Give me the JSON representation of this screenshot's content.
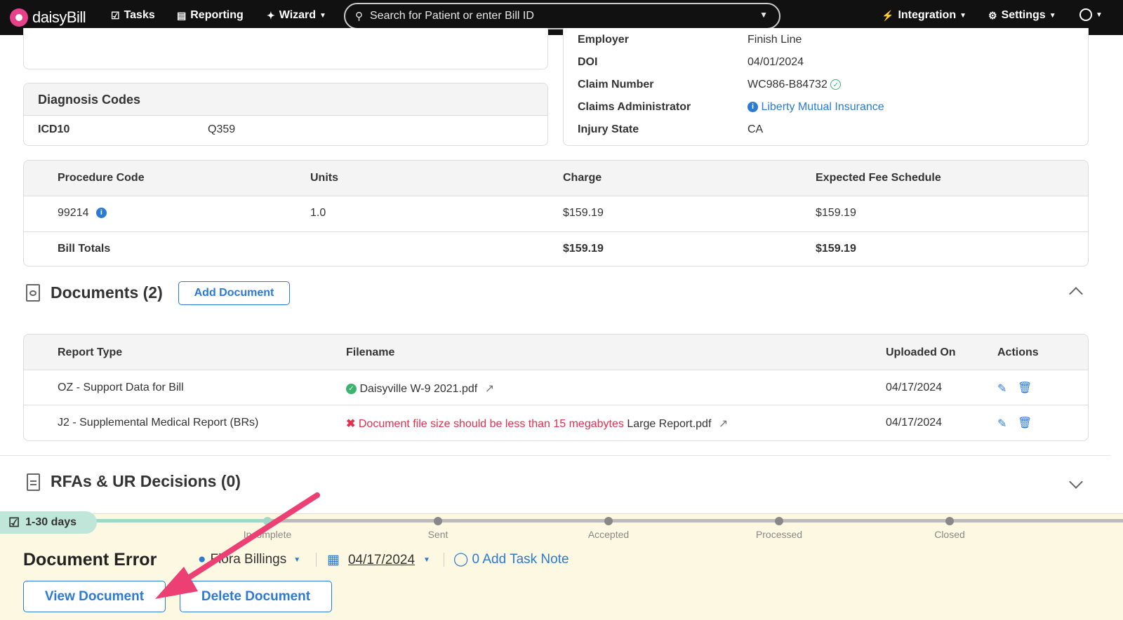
{
  "nav": {
    "logo_text": "daisyBill",
    "tasks": "Tasks",
    "reporting": "Reporting",
    "wizard": "Wizard",
    "search_placeholder": "Search for Patient or enter Bill ID",
    "integration": "Integration",
    "settings": "Settings"
  },
  "claim": {
    "rows": [
      {
        "label": "Employer",
        "value": "Finish Line"
      },
      {
        "label": "DOI",
        "value": "04/01/2024"
      },
      {
        "label": "Claim Number",
        "value": "WC986-B84732"
      },
      {
        "label": "Claims Administrator",
        "value": "Liberty Mutual Insurance"
      },
      {
        "label": "Injury State",
        "value": "CA"
      }
    ]
  },
  "diagnosis": {
    "title": "Diagnosis Codes",
    "code_type": "ICD10",
    "code": "Q359"
  },
  "procedures": {
    "headers": [
      "Procedure Code",
      "Units",
      "Charge",
      "Expected Fee Schedule"
    ],
    "row": {
      "code": "99214",
      "units": "1.0",
      "charge": "$159.19",
      "expected": "$159.19"
    },
    "totals": {
      "label": "Bill Totals",
      "charge": "$159.19",
      "expected": "$159.19"
    }
  },
  "documents": {
    "title": "Documents (2)",
    "add_button": "Add Document",
    "headers": [
      "Report Type",
      "Filename",
      "Uploaded On",
      "Actions"
    ],
    "rows": [
      {
        "report_type": "OZ - Support Data for Bill",
        "error": "",
        "filename": "Daisyville W-9 2021.pdf",
        "uploaded": "04/17/2024"
      },
      {
        "report_type": "J2 - Supplemental Medical Report (BRs)",
        "error": "Document file size should be less than 15 megabytes",
        "filename": "Large Report.pdf",
        "uploaded": "04/17/2024"
      }
    ]
  },
  "rfas": {
    "title": "RFAs & UR Decisions (0)"
  },
  "status": {
    "days_badge": "1-30 days",
    "steps": [
      "Incomplete",
      "Sent",
      "Accepted",
      "Processed",
      "Closed"
    ],
    "progress": 0.24,
    "title": "Document Error",
    "assignee": "Flora Billings",
    "date": "04/17/2024",
    "task_note": "0 Add Task Note",
    "view_button": "View Document",
    "delete_button": "Delete Document"
  },
  "colors": {
    "accent": "#2a7ad6",
    "error": "#e0314f",
    "arrow": "#ec3f74"
  }
}
